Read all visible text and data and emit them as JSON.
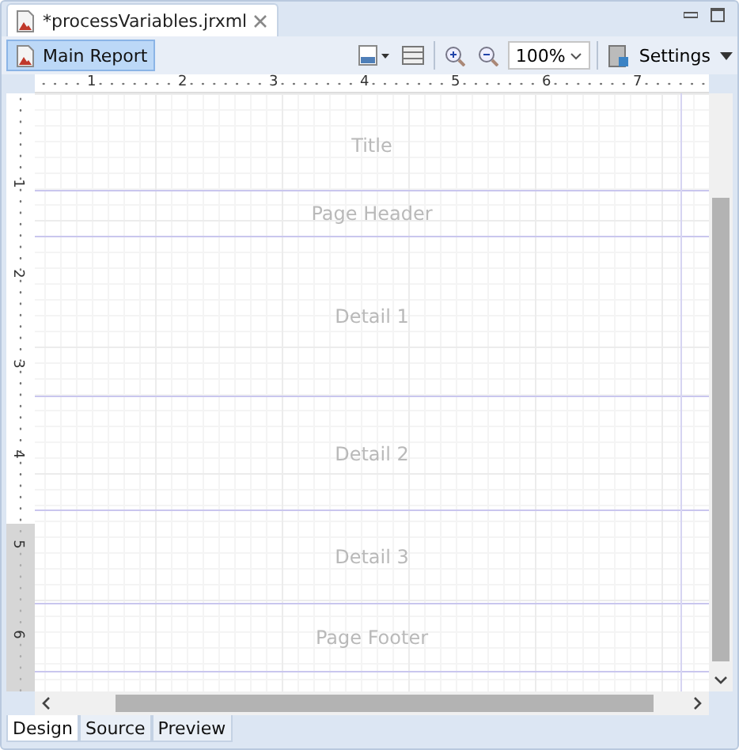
{
  "editor_tab": {
    "title": "*processVariables.jrxml"
  },
  "toolbar": {
    "main_report": {
      "label": "Main Report",
      "selected": true
    },
    "zoom": "100%",
    "settings": "Settings"
  },
  "ruler": {
    "horizontal_labels": [
      "1",
      "2",
      "3",
      "4",
      "5",
      "6",
      "7"
    ],
    "vertical_labels": [
      "1",
      "2",
      "3",
      "4",
      "5",
      "6"
    ]
  },
  "bands": [
    {
      "name": "Title"
    },
    {
      "name": "Page Header"
    },
    {
      "name": "Detail 1"
    },
    {
      "name": "Detail 2"
    },
    {
      "name": "Detail 3"
    },
    {
      "name": "Page Footer"
    }
  ],
  "bottom_tabs": [
    {
      "label": "Design",
      "selected": true
    },
    {
      "label": "Source",
      "selected": false
    },
    {
      "label": "Preview",
      "selected": false
    }
  ]
}
